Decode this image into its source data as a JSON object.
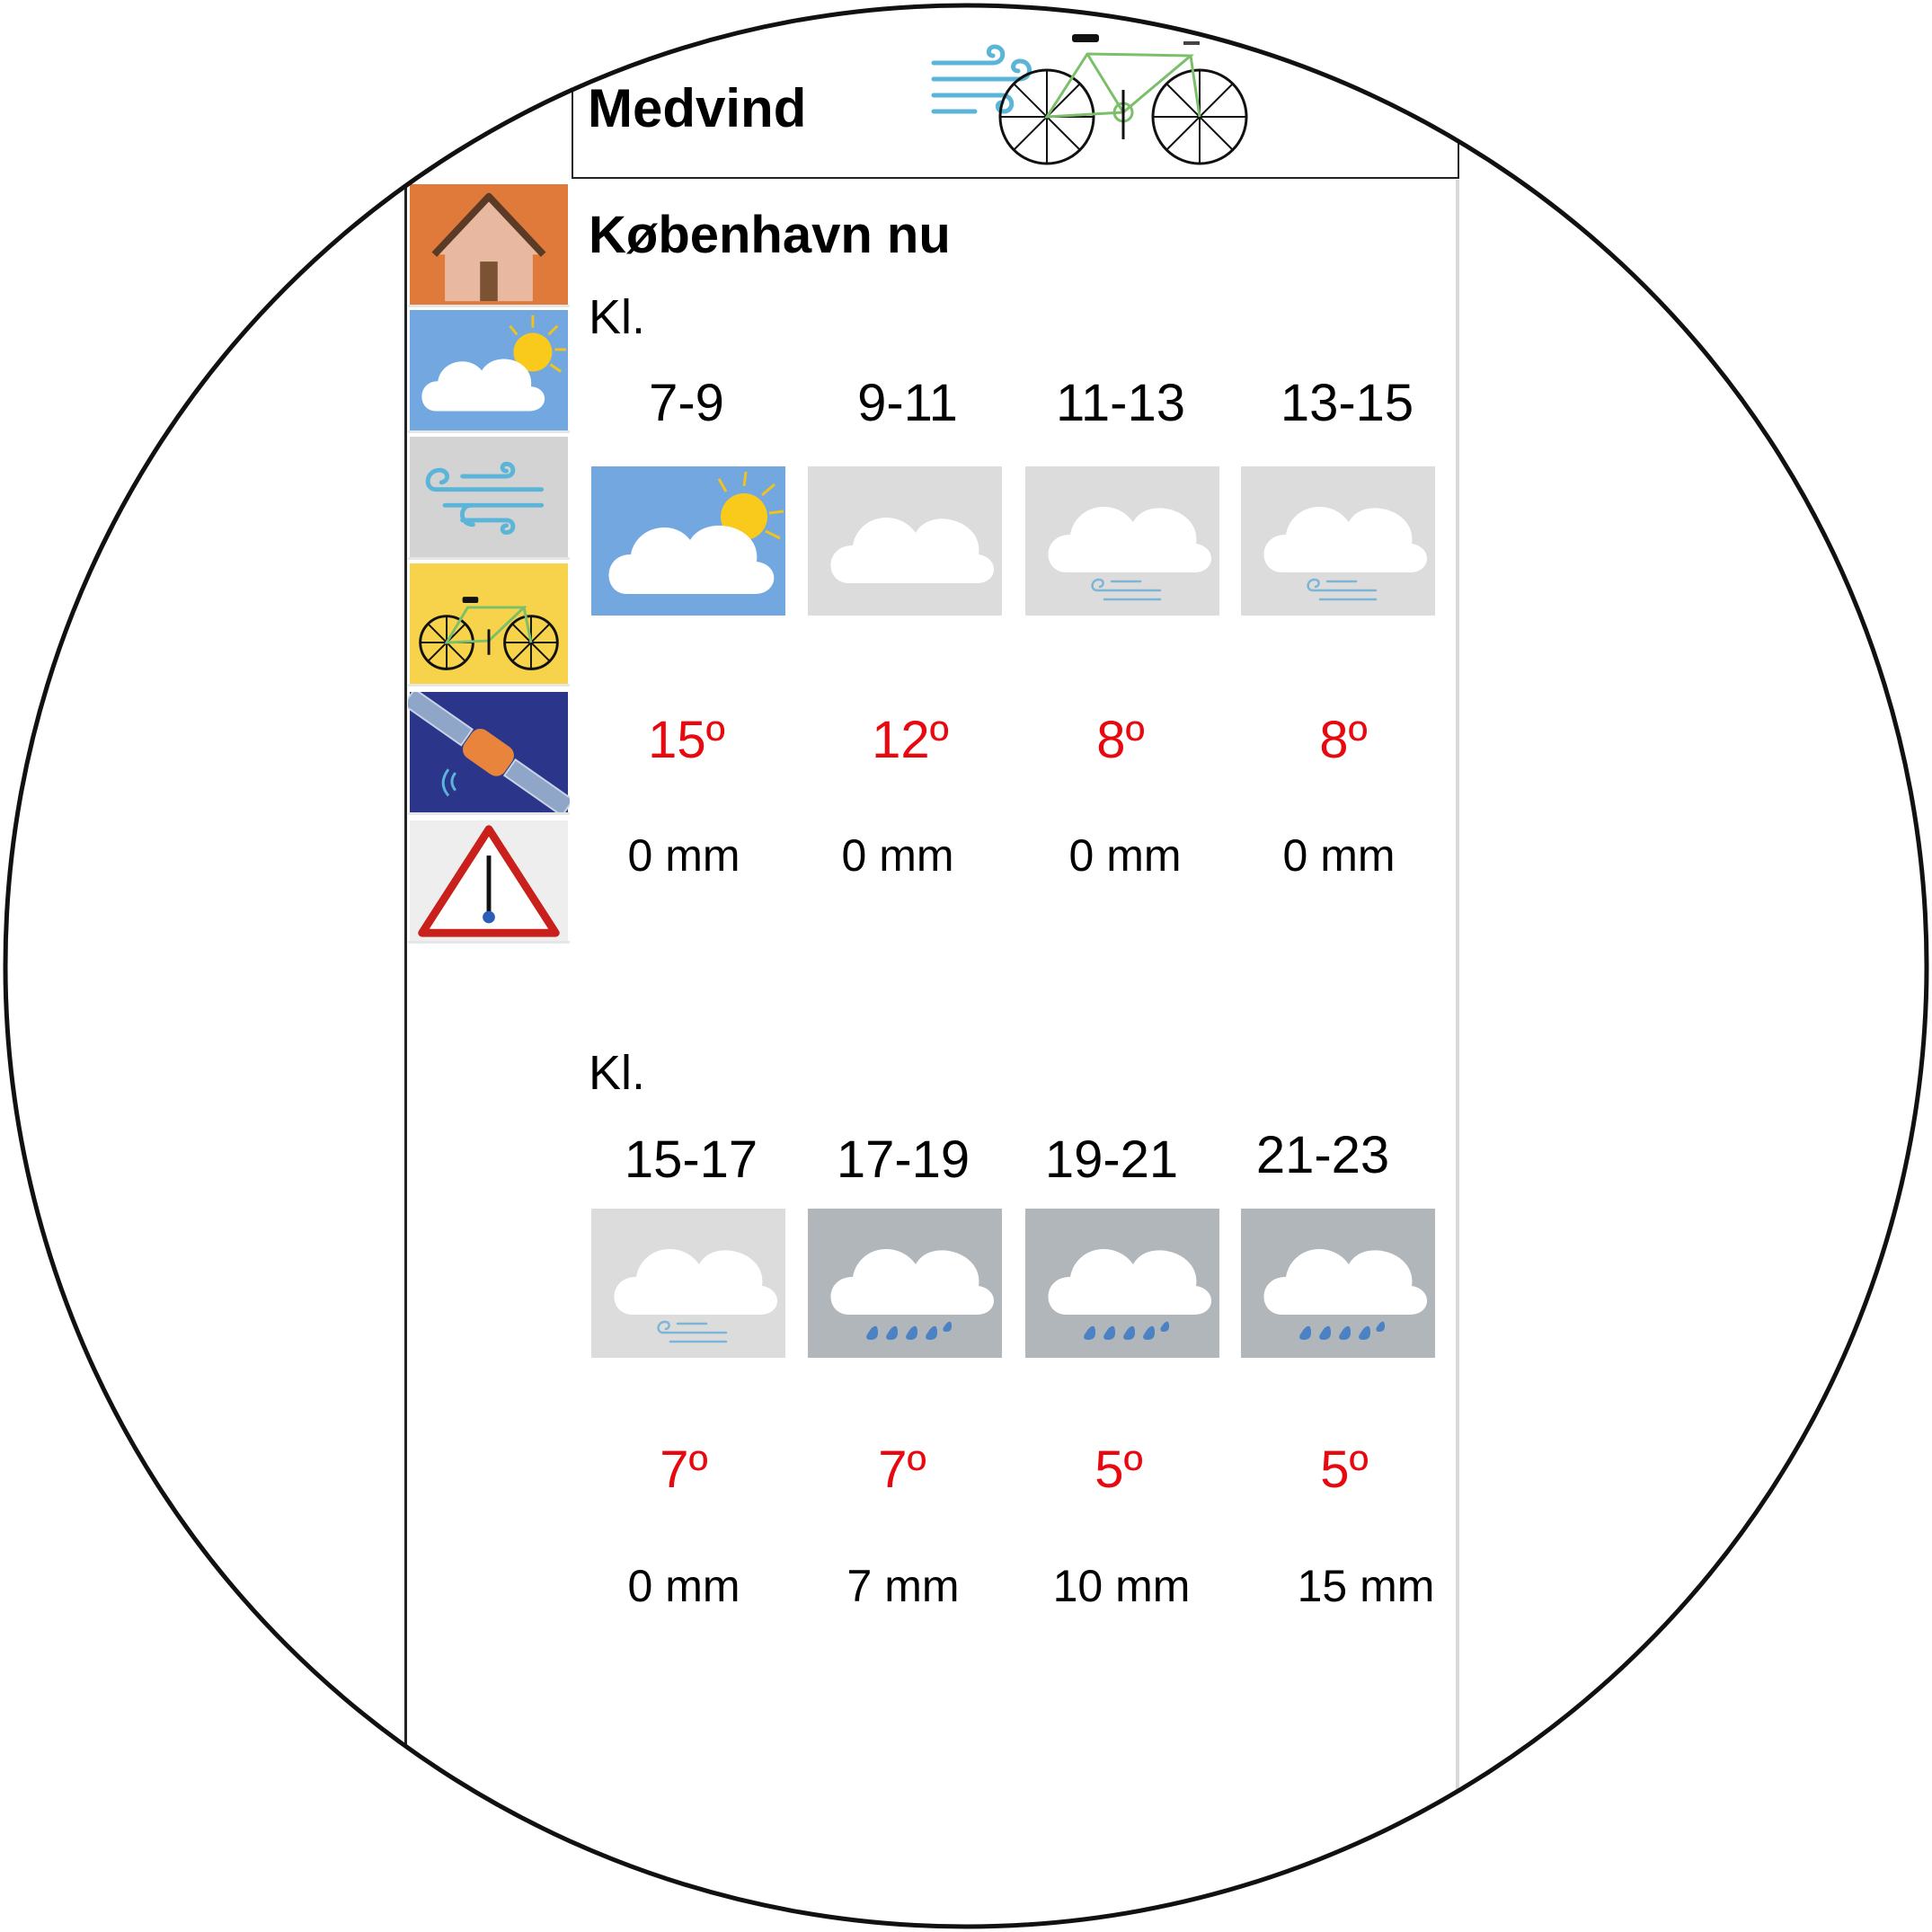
{
  "app": {
    "title": "Medvind",
    "logo_icon": "wind-bicycle-logo"
  },
  "sidebar": {
    "items": [
      {
        "name": "home",
        "icon": "house-icon",
        "color": "#e07a3a"
      },
      {
        "name": "weather",
        "icon": "sun-cloud-icon",
        "color": "#72a8df"
      },
      {
        "name": "wind",
        "icon": "wind-icon",
        "color": "#d3d3d3"
      },
      {
        "name": "bike",
        "icon": "bicycle-icon",
        "color": "#f6d34a"
      },
      {
        "name": "satellite",
        "icon": "satellite-icon",
        "color": "#2b358a"
      },
      {
        "name": "warning",
        "icon": "temperature-warning-icon",
        "color": "#eeeeee"
      }
    ]
  },
  "main": {
    "heading": "København nu",
    "sections": [
      {
        "label": "Kl.",
        "slots": [
          {
            "time": "7-9",
            "icon": "partly-sunny",
            "temp": "15º",
            "rain": "0 mm"
          },
          {
            "time": "9-11",
            "icon": "cloudy",
            "temp": "12º",
            "rain": "0 mm"
          },
          {
            "time": "11-13",
            "icon": "cloudy-windy",
            "temp": "8º",
            "rain": "0 mm"
          },
          {
            "time": "13-15",
            "icon": "cloudy-windy",
            "temp": "8º",
            "rain": "0 mm"
          }
        ]
      },
      {
        "label": "Kl.",
        "slots": [
          {
            "time": "15-17",
            "icon": "cloudy-windy",
            "temp": "7º",
            "rain": "0 mm"
          },
          {
            "time": "17-19",
            "icon": "rain",
            "temp": "7º",
            "rain": "7 mm"
          },
          {
            "time": "19-21",
            "icon": "rain",
            "temp": "5º",
            "rain": "10 mm"
          },
          {
            "time": "21-23",
            "icon": "rain",
            "temp": "5º",
            "rain": "15 mm"
          }
        ]
      }
    ]
  },
  "colors": {
    "temperature": "#e8080f",
    "sky_blue": "#72a8df",
    "overcast": "#dcdcdc",
    "rain_bg": "#b1b6bb",
    "rain_drops": "#4a82c4"
  }
}
